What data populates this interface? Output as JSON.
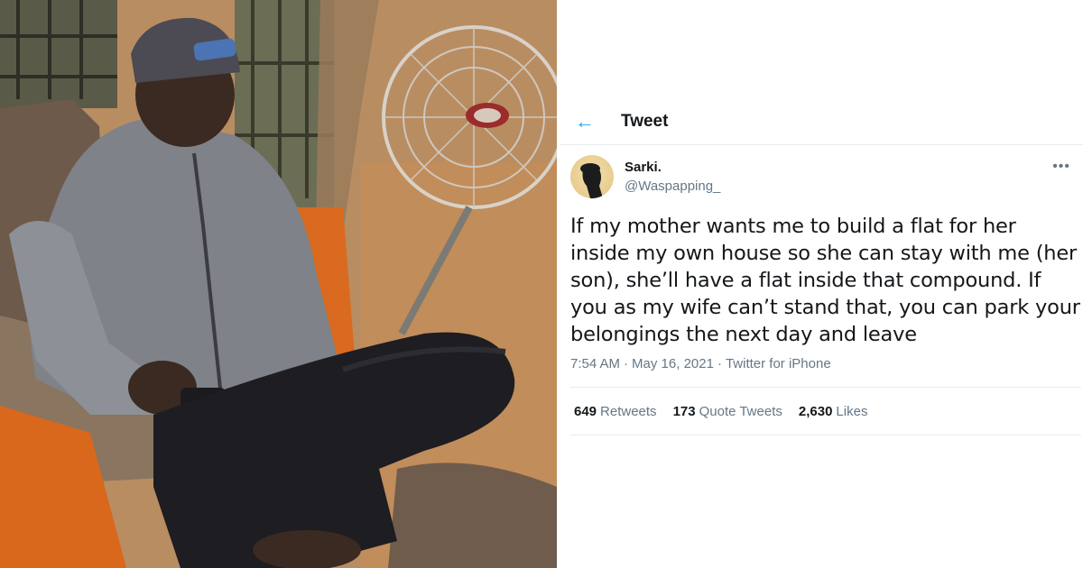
{
  "header": {
    "title": "Tweet",
    "back_icon": "arrow-left-icon",
    "accent": "#1da1f2"
  },
  "author": {
    "name": "Sarki.",
    "handle": "@Waspapping_"
  },
  "tweet": {
    "text": "If my mother wants me to build a flat for her inside my own house so she can stay with me (her son), she’ll have a flat inside that compound. If you as my wife can’t stand that, you can park your belongings the next day and leave",
    "time": "7:54 AM",
    "date": "May 16, 2021",
    "source": "Twitter for iPhone"
  },
  "stats": {
    "retweets_count": "649",
    "retweets_label": "Retweets",
    "quotes_count": "173",
    "quotes_label": "Quote Tweets",
    "likes_count": "2,630",
    "likes_label": "Likes"
  }
}
